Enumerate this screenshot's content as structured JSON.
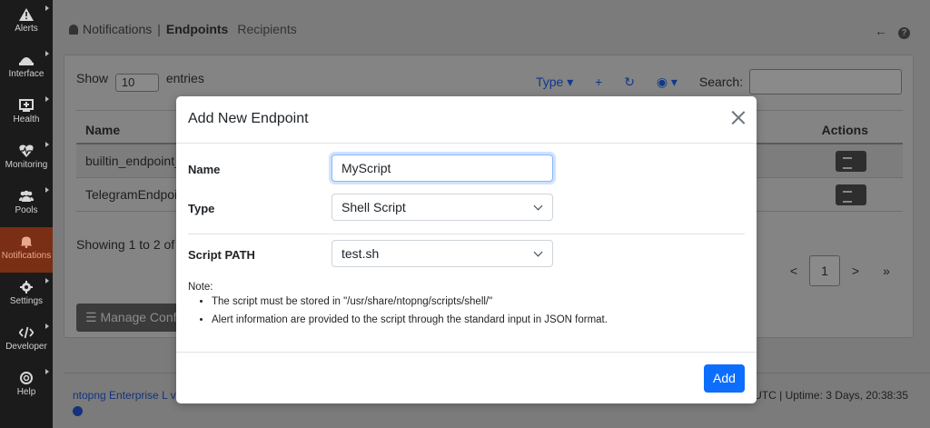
{
  "sidebar": {
    "items": [
      {
        "label": "Alerts",
        "icon": "warning-icon"
      },
      {
        "label": "Interface",
        "icon": "interface-icon"
      },
      {
        "label": "Health",
        "icon": "health-icon"
      },
      {
        "label": "Monitoring",
        "icon": "heart-icon"
      },
      {
        "label": "Pools",
        "icon": "users-icon"
      },
      {
        "label": "Notifications",
        "icon": "bell-icon"
      },
      {
        "label": "Settings",
        "icon": "gear-icon"
      },
      {
        "label": "Developer",
        "icon": "code-icon"
      },
      {
        "label": "Help",
        "icon": "lifebuoy-icon"
      }
    ],
    "active": "Notifications"
  },
  "header": {
    "section": "Notifications",
    "separator": "|",
    "active_tab": "Endpoints",
    "tab2": "Recipients"
  },
  "table_controls": {
    "show_label": "Show",
    "entries_value": "10",
    "entries_label": "entries",
    "type_filter": "Type",
    "search_label": "Search:"
  },
  "table": {
    "columns": [
      "Name",
      "Actions"
    ],
    "rows": [
      {
        "name": "builtin_endpoint_"
      },
      {
        "name": "TelegramEndpoint"
      }
    ],
    "showing": "Showing 1 to 2 of 2",
    "pager": [
      "<",
      "1",
      ">",
      "»"
    ]
  },
  "manage_button": "Manage Configurations",
  "footer": {
    "left": "ntopng Enterprise L v.",
    "right": "UTC | Uptime: 3 Days, 20:38:35"
  },
  "modal": {
    "title": "Add New Endpoint",
    "name_label": "Name",
    "name_value": "MyScript",
    "type_label": "Type",
    "type_value": "Shell Script",
    "path_label": "Script PATH",
    "path_value": "test.sh",
    "note_title": "Note:",
    "notes": [
      "The script must be stored in \"/usr/share/ntopng/scripts/shell/\"",
      "Alert information are provided to the script through the standard input in JSON format."
    ],
    "add_label": "Add"
  },
  "colors": {
    "primary": "#0d6efd",
    "sidebar_bg": "#1b1b1b",
    "active_sidebar": "#ff5a1f"
  }
}
